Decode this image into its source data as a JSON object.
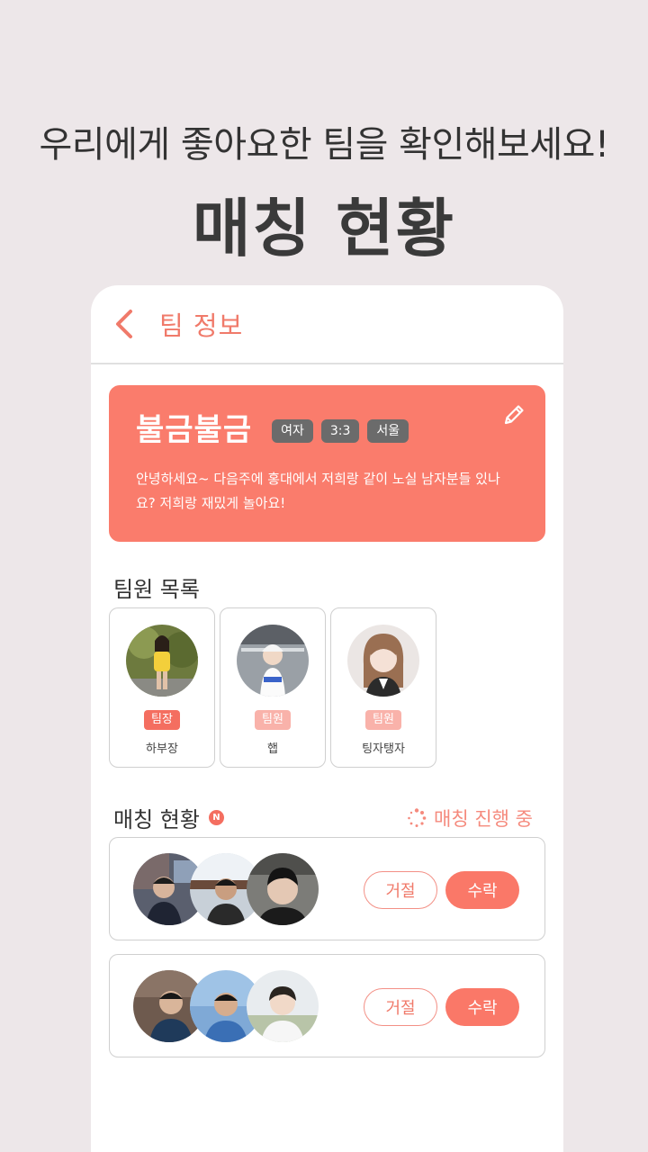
{
  "promo": {
    "subtitle": "우리에게 좋아요한 팀을 확인해보세요!",
    "title": "매칭 현황"
  },
  "header": {
    "title": "팀 정보"
  },
  "team": {
    "name": "불금불금",
    "tags": [
      "여자",
      "3:3",
      "서울"
    ],
    "description": "안녕하세요~ 다음주에 홍대에서 저희랑 같이 노실 남자분들 있나요? 저희랑 재밌게 놀아요!"
  },
  "members_section": {
    "title": "팀원 목록",
    "members": [
      {
        "role": "팀장",
        "name": "하부장"
      },
      {
        "role": "팀원",
        "name": "햅"
      },
      {
        "role": "팀원",
        "name": "팅자탱자"
      }
    ]
  },
  "matching_section": {
    "title": "매칭 현황",
    "new_badge": "N",
    "status": "매칭 진행 중",
    "requests": [
      {
        "reject_label": "거절",
        "accept_label": "수락"
      },
      {
        "reject_label": "거절",
        "accept_label": "수락"
      }
    ]
  },
  "colors": {
    "accent": "#fa7c6c",
    "background": "#ede7e9",
    "tag": "#6b6b6b"
  }
}
